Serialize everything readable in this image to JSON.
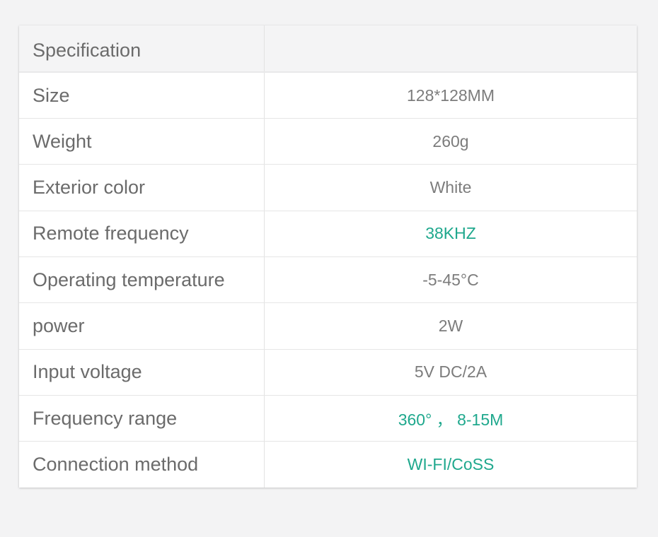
{
  "specs": {
    "header": {
      "label": "Specification",
      "value": ""
    },
    "rows": [
      {
        "label": "Size",
        "value": "128*128MM"
      },
      {
        "label": "Weight",
        "value": "260g"
      },
      {
        "label": "Exterior color",
        "value": "White"
      },
      {
        "label": "Remote frequency",
        "value": "38KHZ"
      },
      {
        "label": "Operating temperature",
        "value": "-5-45°C"
      },
      {
        "label": "power",
        "value": "2W"
      },
      {
        "label": "Input voltage",
        "value": "5V DC/2A"
      },
      {
        "label": "Frequency range",
        "value": "360° ， 8-15M"
      },
      {
        "label": "Connection method",
        "value": "WI-FI/CoSS"
      }
    ]
  },
  "colors": {
    "accent": "#1fa88d",
    "label_text": "#6b6b6b",
    "value_text": "#7c7c7c",
    "header_bg": "#f4f4f5",
    "page_bg": "#f3f3f4"
  }
}
